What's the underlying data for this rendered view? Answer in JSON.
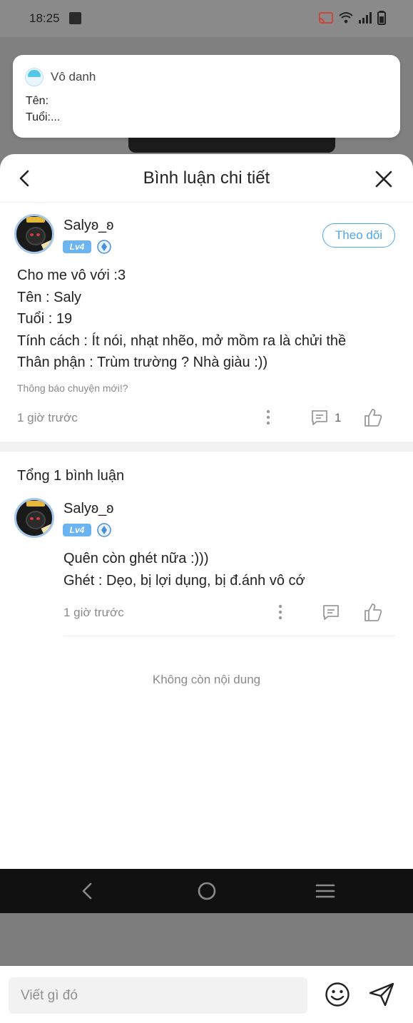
{
  "status_bar": {
    "time": "18:25"
  },
  "notification": {
    "app_name": "Vô danh",
    "line1": "Tên:",
    "line2": "Tuổi:..."
  },
  "sheet": {
    "title": "Bình luận chi tiết"
  },
  "post": {
    "username": "Salyʚ_ʚ",
    "level": "Lv4",
    "follow_label": "Theo dõi",
    "lines": [
      "Cho me vô với :3",
      "Tên : Saly",
      "Tuổi : 19",
      "Tính cách : Ít nói, nhạt nhẽo, mở mồm ra là chửi thề",
      "Thân phận : Trùm trường ? Nhà giàu :))"
    ],
    "note": "Thông báo chuyện mới!?",
    "time": "1 giờ trước",
    "comment_count": "1"
  },
  "comments": {
    "total_label": "Tổng 1 bình luận",
    "items": [
      {
        "username": "Salyʚ_ʚ",
        "level": "Lv4",
        "lines": [
          "Quên còn ghét nữa :)))",
          "Ghét : Dẹo, bị lợi dụng, bị đ.ánh vô cớ"
        ],
        "time": "1 giờ trước"
      }
    ],
    "end_text": "Không còn nội dung"
  },
  "composer": {
    "placeholder": "Viết gì đó"
  },
  "colors": {
    "accent": "#4fa7e8",
    "level_badge": "#6ab4f2"
  }
}
